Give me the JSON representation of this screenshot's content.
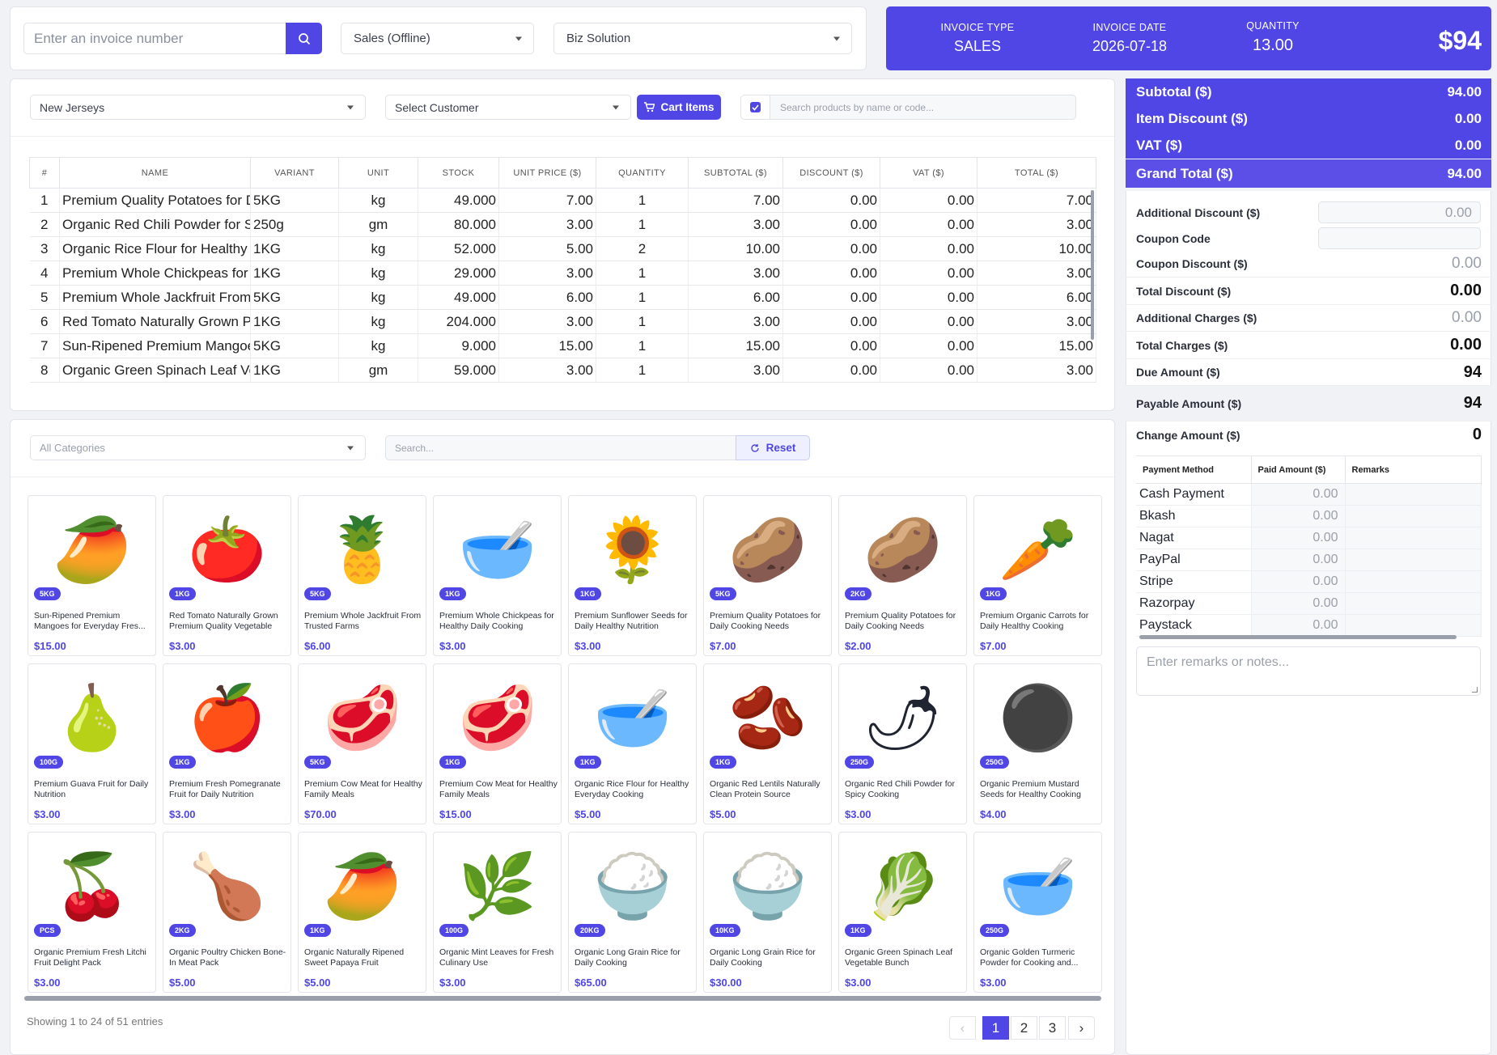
{
  "header": {
    "invoice_placeholder": "Enter an invoice number",
    "sale_type": "Sales (Offline)",
    "business": "Biz Solution"
  },
  "banner": {
    "invoice_type_label": "INVOICE TYPE",
    "invoice_type": "SALES",
    "invoice_date_label": "INVOICE DATE",
    "invoice_date": "2026-07-18",
    "quantity_label": "QUANTITY",
    "quantity": "13.00",
    "amount": "$94",
    "accent": "#4f46e5"
  },
  "cart": {
    "category": "New Jerseys",
    "customer": "Select Customer",
    "cart_button": "Cart Items",
    "search_placeholder": "Search products by name or code...",
    "columns": [
      "#",
      "NAME",
      "VARIANT",
      "UNIT",
      "STOCK",
      "UNIT PRICE ($)",
      "QUANTITY",
      "SUBTOTAL ($)",
      "DISCOUNT ($)",
      "VAT ($)",
      "TOTAL ($)"
    ],
    "rows": [
      [
        "1",
        "Premium Quality Potatoes for Daily Cooking Needs",
        "5KG",
        "kg",
        "49.000",
        "7.00",
        "1",
        "7.00",
        "0.00",
        "0.00",
        "7.00"
      ],
      [
        "2",
        "Organic Red Chili Powder for Spicy Cooking",
        "250g",
        "gm",
        "80.000",
        "3.00",
        "1",
        "3.00",
        "0.00",
        "0.00",
        "3.00"
      ],
      [
        "3",
        "Organic Rice Flour for Healthy Everyday Cooking",
        "1KG",
        "kg",
        "52.000",
        "5.00",
        "2",
        "10.00",
        "0.00",
        "0.00",
        "10.00"
      ],
      [
        "4",
        "Premium Whole Chickpeas for Healthy Daily Cooking",
        "1KG",
        "kg",
        "29.000",
        "3.00",
        "1",
        "3.00",
        "0.00",
        "0.00",
        "3.00"
      ],
      [
        "5",
        "Premium Whole Jackfruit From Trusted Farms",
        "5KG",
        "kg",
        "49.000",
        "6.00",
        "1",
        "6.00",
        "0.00",
        "0.00",
        "6.00"
      ],
      [
        "6",
        "Red Tomato Naturally Grown Premium Quality Vegetable",
        "1KG",
        "kg",
        "204.000",
        "3.00",
        "1",
        "3.00",
        "0.00",
        "0.00",
        "3.00"
      ],
      [
        "7",
        "Sun-Ripened Premium Mangoes for Everyday Fresh",
        "5KG",
        "kg",
        "9.000",
        "15.00",
        "1",
        "15.00",
        "0.00",
        "0.00",
        "15.00"
      ],
      [
        "8",
        "Organic Green Spinach Leaf Vegetable Bunch",
        "1KG",
        "gm",
        "59.000",
        "3.00",
        "1",
        "3.00",
        "0.00",
        "0.00",
        "3.00"
      ]
    ]
  },
  "summary": {
    "subtotal_label": "Subtotal ($)",
    "subtotal": "94.00",
    "item_discount_label": "Item Discount ($)",
    "item_discount": "0.00",
    "vat_label": "VAT ($)",
    "vat": "0.00",
    "grand_total_label": "Grand Total ($)",
    "grand_total": "94.00",
    "additional_discount_label": "Additional Discount ($)",
    "additional_discount": "0.00",
    "coupon_code_label": "Coupon Code",
    "coupon_discount_label": "Coupon Discount ($)",
    "coupon_discount": "0.00",
    "total_discount_label": "Total Discount ($)",
    "total_discount": "0.00",
    "additional_charges_label": "Additional Charges ($)",
    "additional_charges": "0.00",
    "total_charges_label": "Total Charges ($)",
    "total_charges": "0.00",
    "due_amount_label": "Due Amount ($)",
    "due_amount": "94",
    "payable_amount_label": "Payable Amount ($)",
    "payable_amount": "94",
    "change_amount_label": "Change Amount ($)",
    "change_amount": "0"
  },
  "payments": {
    "columns": [
      "Payment Method",
      "Paid Amount ($)",
      "Remarks"
    ],
    "rows": [
      {
        "method": "Cash Payment",
        "amount": "0.00"
      },
      {
        "method": "Bkash",
        "amount": "0.00"
      },
      {
        "method": "Nagat",
        "amount": "0.00"
      },
      {
        "method": "PayPal",
        "amount": "0.00"
      },
      {
        "method": "Stripe",
        "amount": "0.00"
      },
      {
        "method": "Razorpay",
        "amount": "0.00"
      },
      {
        "method": "Paystack",
        "amount": "0.00"
      }
    ],
    "remarks_placeholder": "Enter remarks or notes..."
  },
  "products_panel": {
    "category": "All Categories",
    "search_placeholder": "Search...",
    "reset_label": "Reset",
    "items": [
      {
        "name": "Sun-Ripened Premium Mangoes for Everyday Fres...",
        "price": "$15.00",
        "badge": "5KG",
        "icon": "🥭"
      },
      {
        "name": "Red Tomato Naturally Grown Premium Quality Vegetable",
        "price": "$3.00",
        "badge": "1KG",
        "icon": "🍅"
      },
      {
        "name": "Premium Whole Jackfruit From Trusted Farms",
        "price": "$6.00",
        "badge": "5KG",
        "icon": "🍍"
      },
      {
        "name": "Premium Whole Chickpeas for Healthy Daily Cooking",
        "price": "$3.00",
        "badge": "1KG",
        "icon": "🥣"
      },
      {
        "name": "Premium Sunflower Seeds for Daily Healthy Nutrition",
        "price": "$3.00",
        "badge": "1KG",
        "icon": "🌻"
      },
      {
        "name": "Premium Quality Potatoes for Daily Cooking Needs",
        "price": "$7.00",
        "badge": "5KG",
        "icon": "🥔"
      },
      {
        "name": "Premium Quality Potatoes for Daily Cooking Needs",
        "price": "$2.00",
        "badge": "2KG",
        "icon": "🥔"
      },
      {
        "name": "Premium Organic Carrots for Daily Healthy Cooking",
        "price": "$7.00",
        "badge": "1KG",
        "icon": "🥕"
      },
      {
        "name": "Premium Guava Fruit for Daily Nutrition",
        "price": "$3.00",
        "badge": "100G",
        "icon": "🍐"
      },
      {
        "name": "Premium Fresh Pomegranate Fruit for Daily Nutrition",
        "price": "$3.00",
        "badge": "1KG",
        "icon": "🍎"
      },
      {
        "name": "Premium Cow Meat for Healthy Family Meals",
        "price": "$70.00",
        "badge": "5KG",
        "icon": "🥩"
      },
      {
        "name": "Premium Cow Meat for Healthy Family Meals",
        "price": "$15.00",
        "badge": "1KG",
        "icon": "🥩"
      },
      {
        "name": "Organic Rice Flour for Healthy Everyday Cooking",
        "price": "$5.00",
        "badge": "1KG",
        "icon": "🥣"
      },
      {
        "name": "Organic Red Lentils Naturally Clean Protein Source",
        "price": "$5.00",
        "badge": "1KG",
        "icon": "🫘"
      },
      {
        "name": "Organic Red Chili Powder for Spicy Cooking",
        "price": "$3.00",
        "badge": "250G",
        "icon": "🌶"
      },
      {
        "name": "Organic Premium Mustard Seeds for Healthy Cooking",
        "price": "$4.00",
        "badge": "250G",
        "icon": "⚫"
      },
      {
        "name": "Organic Premium Fresh Litchi Fruit Delight Pack",
        "price": "$3.00",
        "badge": "PCS",
        "icon": "🍒"
      },
      {
        "name": "Organic Poultry Chicken Bone-In Meat Pack",
        "price": "$5.00",
        "badge": "2KG",
        "icon": "🍗"
      },
      {
        "name": "Organic Naturally Ripened Sweet Papaya Fruit",
        "price": "$5.00",
        "badge": "1KG",
        "icon": "🥭"
      },
      {
        "name": "Organic Mint Leaves for Fresh Culinary Use",
        "price": "$3.00",
        "badge": "100G",
        "icon": "🌿"
      },
      {
        "name": "Organic Long Grain Rice for Daily Cooking",
        "price": "$65.00",
        "badge": "20KG",
        "icon": "🍚"
      },
      {
        "name": "Organic Long Grain Rice for Daily Cooking",
        "price": "$30.00",
        "badge": "10KG",
        "icon": "🍚"
      },
      {
        "name": "Organic Green Spinach Leaf Vegetable Bunch",
        "price": "$3.00",
        "badge": "1KG",
        "icon": "🥬"
      },
      {
        "name": "Organic Golden Turmeric Powder for Cooking and...",
        "price": "$3.00",
        "badge": "250G",
        "icon": "🥣"
      }
    ],
    "showing_text": "Showing 1 to 24 of 51 entries",
    "pages": [
      "1",
      "2",
      "3"
    ]
  }
}
